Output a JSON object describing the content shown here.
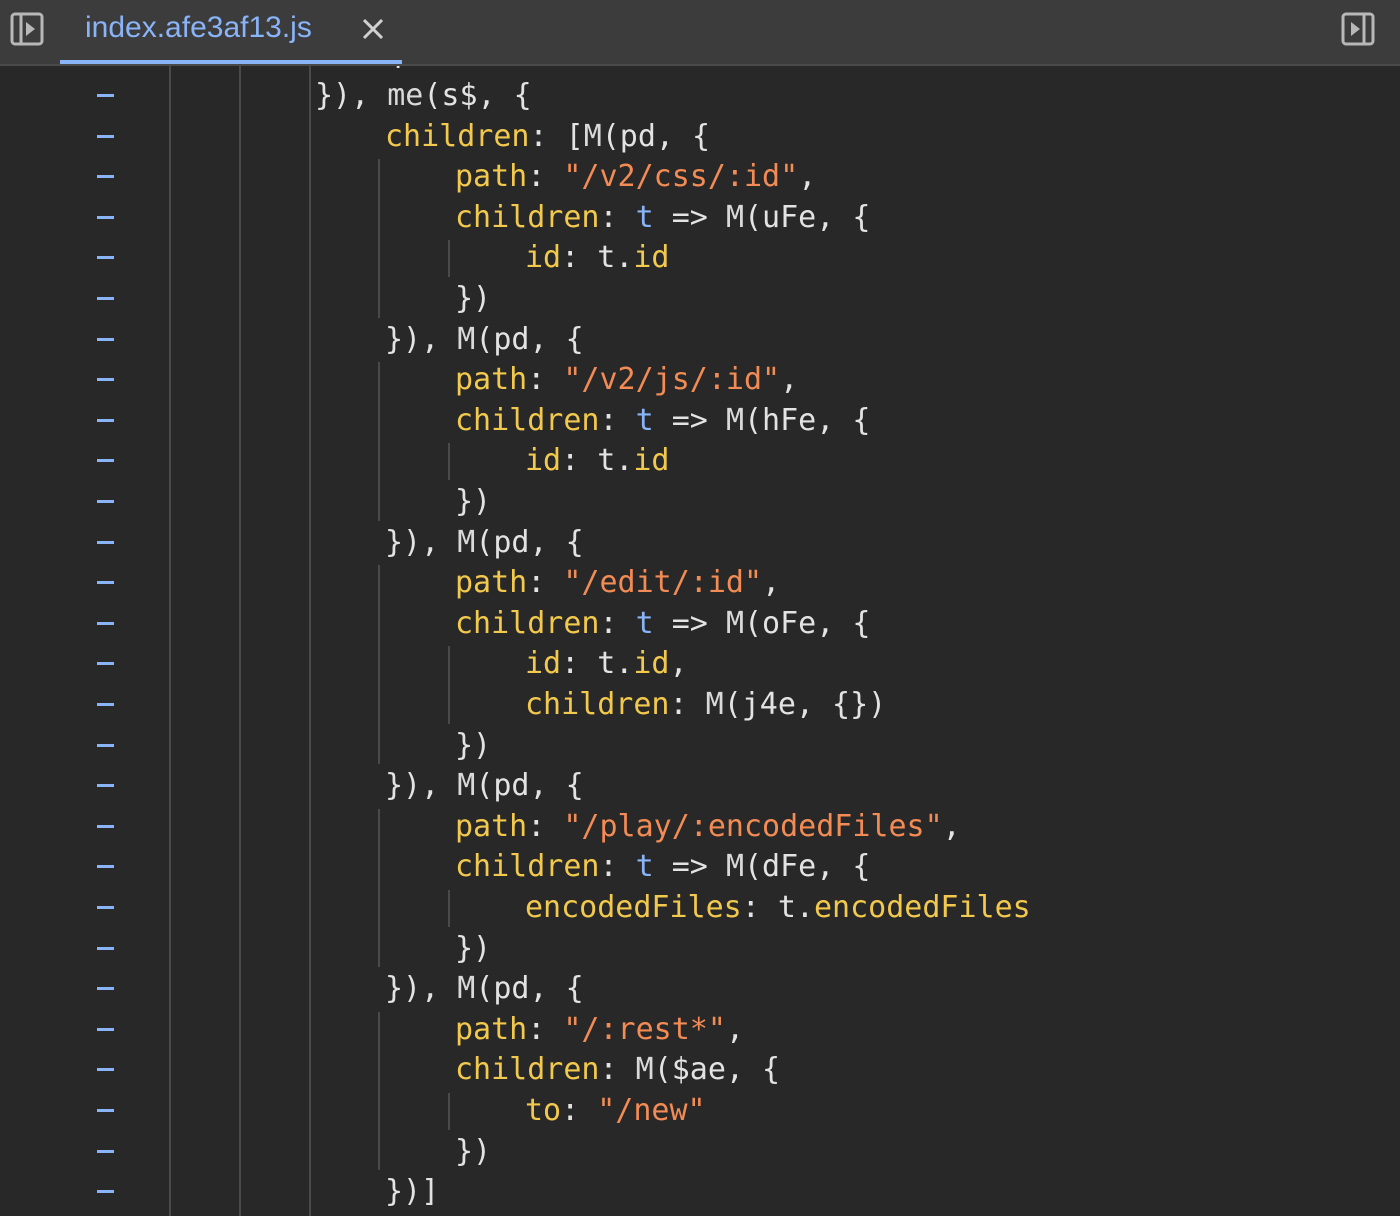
{
  "tab": {
    "filename": "index.afe3af13.js"
  },
  "icons": {
    "left_toggle": "sidebar-left-icon",
    "right_toggle": "sidebar-right-icon",
    "close": "close-icon"
  },
  "colors": {
    "tabbar_bg": "#3c3c3c",
    "editor_bg": "#282828",
    "accent": "#8ab4f8",
    "property_key": "#f2c94c",
    "string": "#f28b54",
    "variable": "#8ab4f8",
    "punctuation": "#e3e3e3"
  },
  "gutter_mark": "–",
  "code": {
    "lines": [
      {
        "indent": 4,
        "tokens": [
          {
            "t": "}), ",
            "c": "p"
          },
          {
            "t": "me",
            "c": "i"
          },
          {
            "t": "(s$, {",
            "c": "p"
          }
        ]
      },
      {
        "indent": 5,
        "tokens": [
          {
            "t": "children",
            "c": "k"
          },
          {
            "t": ": [",
            "c": "p"
          },
          {
            "t": "M",
            "c": "i"
          },
          {
            "t": "(pd, {",
            "c": "p"
          }
        ]
      },
      {
        "indent": 6,
        "tokens": [
          {
            "t": "path",
            "c": "k"
          },
          {
            "t": ": ",
            "c": "p"
          },
          {
            "t": "\"/v2/css/:id\"",
            "c": "s"
          },
          {
            "t": ",",
            "c": "p"
          }
        ]
      },
      {
        "indent": 6,
        "tokens": [
          {
            "t": "children",
            "c": "k"
          },
          {
            "t": ": ",
            "c": "p"
          },
          {
            "t": "t",
            "c": "v"
          },
          {
            "t": " => ",
            "c": "p"
          },
          {
            "t": "M",
            "c": "i"
          },
          {
            "t": "(uFe, {",
            "c": "p"
          }
        ]
      },
      {
        "indent": 7,
        "tokens": [
          {
            "t": "id",
            "c": "k"
          },
          {
            "t": ": t.",
            "c": "p"
          },
          {
            "t": "id",
            "c": "k"
          }
        ]
      },
      {
        "indent": 6,
        "tokens": [
          {
            "t": "})",
            "c": "p"
          }
        ]
      },
      {
        "indent": 5,
        "tokens": [
          {
            "t": "}), ",
            "c": "p"
          },
          {
            "t": "M",
            "c": "i"
          },
          {
            "t": "(pd, {",
            "c": "p"
          }
        ]
      },
      {
        "indent": 6,
        "tokens": [
          {
            "t": "path",
            "c": "k"
          },
          {
            "t": ": ",
            "c": "p"
          },
          {
            "t": "\"/v2/js/:id\"",
            "c": "s"
          },
          {
            "t": ",",
            "c": "p"
          }
        ]
      },
      {
        "indent": 6,
        "tokens": [
          {
            "t": "children",
            "c": "k"
          },
          {
            "t": ": ",
            "c": "p"
          },
          {
            "t": "t",
            "c": "v"
          },
          {
            "t": " => ",
            "c": "p"
          },
          {
            "t": "M",
            "c": "i"
          },
          {
            "t": "(hFe, {",
            "c": "p"
          }
        ]
      },
      {
        "indent": 7,
        "tokens": [
          {
            "t": "id",
            "c": "k"
          },
          {
            "t": ": t.",
            "c": "p"
          },
          {
            "t": "id",
            "c": "k"
          }
        ]
      },
      {
        "indent": 6,
        "tokens": [
          {
            "t": "})",
            "c": "p"
          }
        ]
      },
      {
        "indent": 5,
        "tokens": [
          {
            "t": "}), ",
            "c": "p"
          },
          {
            "t": "M",
            "c": "i"
          },
          {
            "t": "(pd, {",
            "c": "p"
          }
        ]
      },
      {
        "indent": 6,
        "tokens": [
          {
            "t": "path",
            "c": "k"
          },
          {
            "t": ": ",
            "c": "p"
          },
          {
            "t": "\"/edit/:id\"",
            "c": "s"
          },
          {
            "t": ",",
            "c": "p"
          }
        ]
      },
      {
        "indent": 6,
        "tokens": [
          {
            "t": "children",
            "c": "k"
          },
          {
            "t": ": ",
            "c": "p"
          },
          {
            "t": "t",
            "c": "v"
          },
          {
            "t": " => ",
            "c": "p"
          },
          {
            "t": "M",
            "c": "i"
          },
          {
            "t": "(oFe, {",
            "c": "p"
          }
        ]
      },
      {
        "indent": 7,
        "tokens": [
          {
            "t": "id",
            "c": "k"
          },
          {
            "t": ": t.",
            "c": "p"
          },
          {
            "t": "id",
            "c": "k"
          },
          {
            "t": ",",
            "c": "p"
          }
        ]
      },
      {
        "indent": 7,
        "tokens": [
          {
            "t": "children",
            "c": "k"
          },
          {
            "t": ": ",
            "c": "p"
          },
          {
            "t": "M",
            "c": "i"
          },
          {
            "t": "(j4e, {})",
            "c": "p"
          }
        ]
      },
      {
        "indent": 6,
        "tokens": [
          {
            "t": "})",
            "c": "p"
          }
        ]
      },
      {
        "indent": 5,
        "tokens": [
          {
            "t": "}), ",
            "c": "p"
          },
          {
            "t": "M",
            "c": "i"
          },
          {
            "t": "(pd, {",
            "c": "p"
          }
        ]
      },
      {
        "indent": 6,
        "tokens": [
          {
            "t": "path",
            "c": "k"
          },
          {
            "t": ": ",
            "c": "p"
          },
          {
            "t": "\"/play/:encodedFiles\"",
            "c": "s"
          },
          {
            "t": ",",
            "c": "p"
          }
        ]
      },
      {
        "indent": 6,
        "tokens": [
          {
            "t": "children",
            "c": "k"
          },
          {
            "t": ": ",
            "c": "p"
          },
          {
            "t": "t",
            "c": "v"
          },
          {
            "t": " => ",
            "c": "p"
          },
          {
            "t": "M",
            "c": "i"
          },
          {
            "t": "(dFe, {",
            "c": "p"
          }
        ]
      },
      {
        "indent": 7,
        "tokens": [
          {
            "t": "encodedFiles",
            "c": "k"
          },
          {
            "t": ": t.",
            "c": "p"
          },
          {
            "t": "encodedFiles",
            "c": "k"
          }
        ]
      },
      {
        "indent": 6,
        "tokens": [
          {
            "t": "})",
            "c": "p"
          }
        ]
      },
      {
        "indent": 5,
        "tokens": [
          {
            "t": "}), ",
            "c": "p"
          },
          {
            "t": "M",
            "c": "i"
          },
          {
            "t": "(pd, {",
            "c": "p"
          }
        ]
      },
      {
        "indent": 6,
        "tokens": [
          {
            "t": "path",
            "c": "k"
          },
          {
            "t": ": ",
            "c": "p"
          },
          {
            "t": "\"/:rest*\"",
            "c": "s"
          },
          {
            "t": ",",
            "c": "p"
          }
        ]
      },
      {
        "indent": 6,
        "tokens": [
          {
            "t": "children",
            "c": "k"
          },
          {
            "t": ": ",
            "c": "p"
          },
          {
            "t": "M",
            "c": "i"
          },
          {
            "t": "($ae, {",
            "c": "p"
          }
        ]
      },
      {
        "indent": 7,
        "tokens": [
          {
            "t": "to",
            "c": "k"
          },
          {
            "t": ": ",
            "c": "p"
          },
          {
            "t": "\"/new\"",
            "c": "s"
          }
        ]
      },
      {
        "indent": 6,
        "tokens": [
          {
            "t": "})",
            "c": "p"
          }
        ]
      },
      {
        "indent": 5,
        "tokens": [
          {
            "t": "})]",
            "c": "p"
          }
        ]
      }
    ]
  }
}
